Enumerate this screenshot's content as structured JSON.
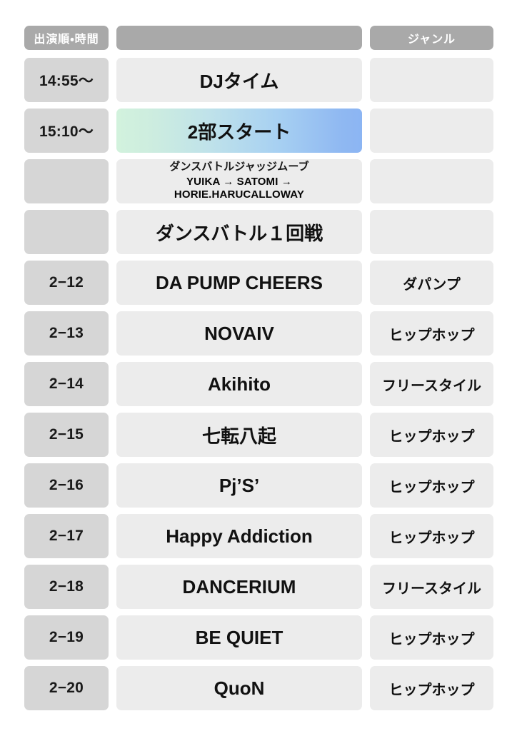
{
  "header": {
    "order_time_label": "出演順・時間",
    "name_label": "",
    "genre_label": "ジャンル"
  },
  "colors": {
    "header_bg": "#a9a9a9",
    "order_cell_bg": "#d6d6d6",
    "cell_bg": "#ececec",
    "highlight_gradient_start": "#d2f2dd",
    "highlight_gradient_end": "#8cb5f3",
    "page_bg": "#ffffff",
    "text": "#111111"
  },
  "rows": [
    {
      "order": "14:55〜",
      "name": "DJタイム",
      "genre": ""
    },
    {
      "order": "15:10〜",
      "name": "2部スタート",
      "genre": "",
      "highlight": true
    },
    {
      "order": "",
      "name": "",
      "genre": "",
      "judge": true,
      "judge_title": "ダンスバトルジャッジムーブ",
      "judge_order": "YUIKA → SATOMI → HORIE.HARUCALLOWAY"
    },
    {
      "order": "",
      "name": "ダンスバトル１回戦",
      "genre": ""
    },
    {
      "order": "2−12",
      "name": "DA PUMP CHEERS",
      "genre": "ダパンプ"
    },
    {
      "order": "2−13",
      "name": "NOVAIV",
      "genre": "ヒップホップ"
    },
    {
      "order": "2−14",
      "name": "Akihito",
      "genre": "フリースタイル"
    },
    {
      "order": "2−15",
      "name": "七転八起",
      "genre": "ヒップホップ"
    },
    {
      "order": "2−16",
      "name": "Pj’S’",
      "genre": "ヒップホップ"
    },
    {
      "order": "2−17",
      "name": "Happy Addiction",
      "genre": "ヒップホップ"
    },
    {
      "order": "2−18",
      "name": "DANCERIUM",
      "genre": "フリースタイル"
    },
    {
      "order": "2−19",
      "name": "BE QUIET",
      "genre": "ヒップホップ"
    },
    {
      "order": "2−20",
      "name": "QuoN",
      "genre": "ヒップホップ"
    }
  ]
}
